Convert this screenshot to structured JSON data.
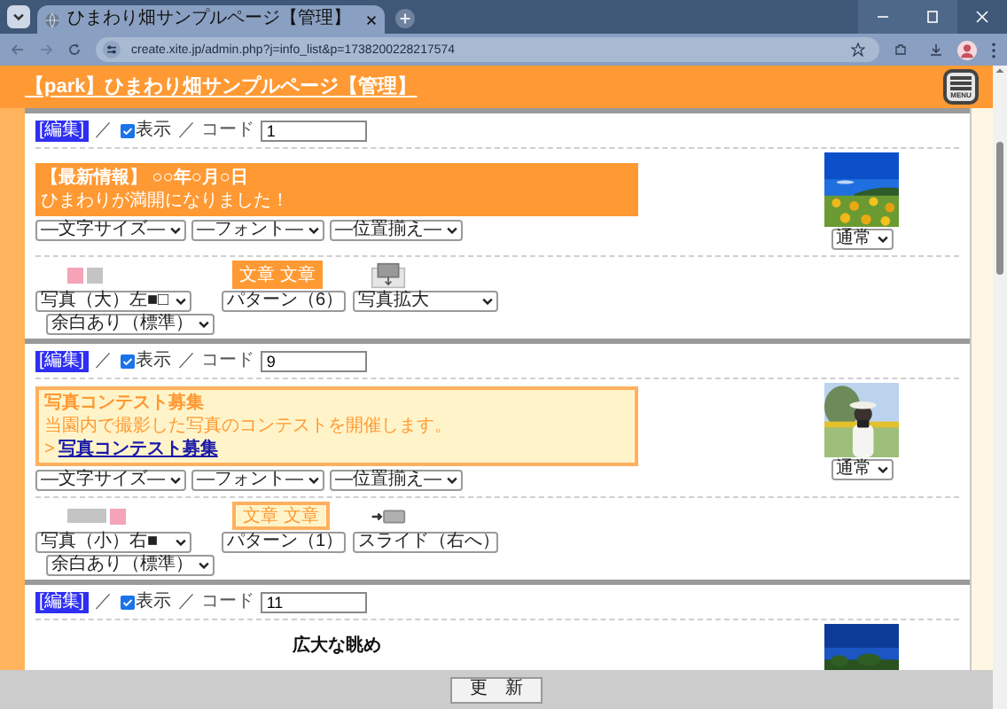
{
  "browser": {
    "tab_title": "ひまわり畑サンプルページ【管理】",
    "url": "create.xite.jp/admin.php?j=info_list&p=1738200228217574"
  },
  "header": {
    "title": "【park】ひまわり畑サンプルページ【管理】",
    "menu_label": "MENU"
  },
  "cards": [
    {
      "edit": "[編集]",
      "sep": "／",
      "visible_label": "表示",
      "visible": true,
      "code_label": "／ コード",
      "code": "1",
      "message": {
        "kind": "filled",
        "lines": [
          {
            "kind": "heading",
            "text": "【最新情報】 ○○年○月○日"
          },
          {
            "kind": "body",
            "text": "ひまわりが満開になりました！"
          }
        ]
      },
      "image_select": "通常",
      "dropdowns": [
        "―文字サイズ―",
        "―フォント―",
        "―位置揃え―"
      ],
      "layout": {
        "swatches": [
          {
            "kind": "square",
            "color": "#f4a3b8"
          },
          {
            "kind": "square",
            "color": "#c4c4c4"
          }
        ],
        "photo_select": "写真（大）左■□",
        "margin_select": "余白あり（標準）",
        "pattern": {
          "kind": "filled",
          "text": "文章 文章"
        },
        "pattern_select": "パターン（6）",
        "effect": {
          "kind": "enlarge",
          "select": "写真拡大"
        }
      }
    },
    {
      "edit": "[編集]",
      "sep": "／",
      "visible_label": "表示",
      "visible": true,
      "code_label": "／ コード",
      "code": "9",
      "message": {
        "kind": "outlined",
        "lines": [
          {
            "kind": "heading",
            "text": "写真コンテスト募集"
          },
          {
            "kind": "body",
            "text": "当園内で撮影した写真のコンテストを開催します。"
          },
          {
            "kind": "link",
            "prefix": ">",
            "text": "写真コンテスト募集"
          }
        ]
      },
      "image_select": "通常",
      "dropdowns": [
        "―文字サイズ―",
        "―フォント―",
        "―位置揃え―"
      ],
      "layout": {
        "swatches": [
          {
            "kind": "bar",
            "color": "#c4c4c4"
          },
          {
            "kind": "square",
            "color": "#f4a3b8"
          }
        ],
        "photo_select": "写真（小）右■",
        "margin_select": "余白あり（標準）",
        "pattern": {
          "kind": "outlined",
          "text": "文章 文章"
        },
        "pattern_select": "パターン（1）",
        "effect": {
          "kind": "slide",
          "select": "スライド（右へ）"
        }
      }
    },
    {
      "edit": "[編集]",
      "sep": "／",
      "visible_label": "表示",
      "visible": true,
      "code_label": "／ コード",
      "code": "11",
      "message": {
        "kind": "plain",
        "lines": [
          {
            "kind": "heading",
            "text": "広大な眺め"
          }
        ]
      }
    }
  ],
  "footer": {
    "update_button": "更　新"
  }
}
